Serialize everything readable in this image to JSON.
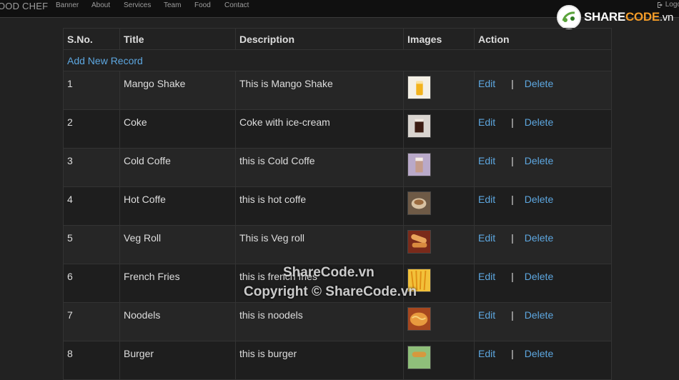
{
  "navbar": {
    "brand": "OOD CHEF",
    "links": [
      "Banner",
      "About",
      "Services",
      "Team",
      "Food",
      "Contact"
    ],
    "logout": "Logo"
  },
  "watermark": {
    "logo_prefix": "SHARE",
    "logo_accent": "CODE",
    "logo_suffix": ".vn",
    "line1": "ShareCode.vn",
    "line2": "Copyright © ShareCode.vn"
  },
  "table": {
    "headers": [
      "S.No.",
      "Title",
      "Description",
      "Images",
      "Action"
    ],
    "add_label": "Add New Record",
    "edit_label": "Edit",
    "separator": "|",
    "delete_label": "Delete",
    "rows": [
      {
        "sno": "1",
        "title": "Mango Shake",
        "description": "This is Mango Shake",
        "image": "mango-shake-image"
      },
      {
        "sno": "2",
        "title": "Coke",
        "description": "Coke with ice-cream",
        "image": "coke-image"
      },
      {
        "sno": "3",
        "title": "Cold Coffe",
        "description": "this is Cold Coffe",
        "image": "cold-coffee-image"
      },
      {
        "sno": "4",
        "title": "Hot Coffe",
        "description": "this is hot coffe",
        "image": "hot-coffee-image"
      },
      {
        "sno": "5",
        "title": "Veg Roll",
        "description": "This is Veg roll",
        "image": "veg-roll-image"
      },
      {
        "sno": "6",
        "title": "French Fries",
        "description": "this is french fries",
        "image": "french-fries-image"
      },
      {
        "sno": "7",
        "title": "Noodels",
        "description": "this is noodels",
        "image": "noodles-image"
      },
      {
        "sno": "8",
        "title": "Burger",
        "description": "this is burger",
        "image": "burger-image"
      }
    ]
  },
  "colors": {
    "background": "#222222",
    "navbar": "#101010",
    "link": "#5da7e0"
  }
}
